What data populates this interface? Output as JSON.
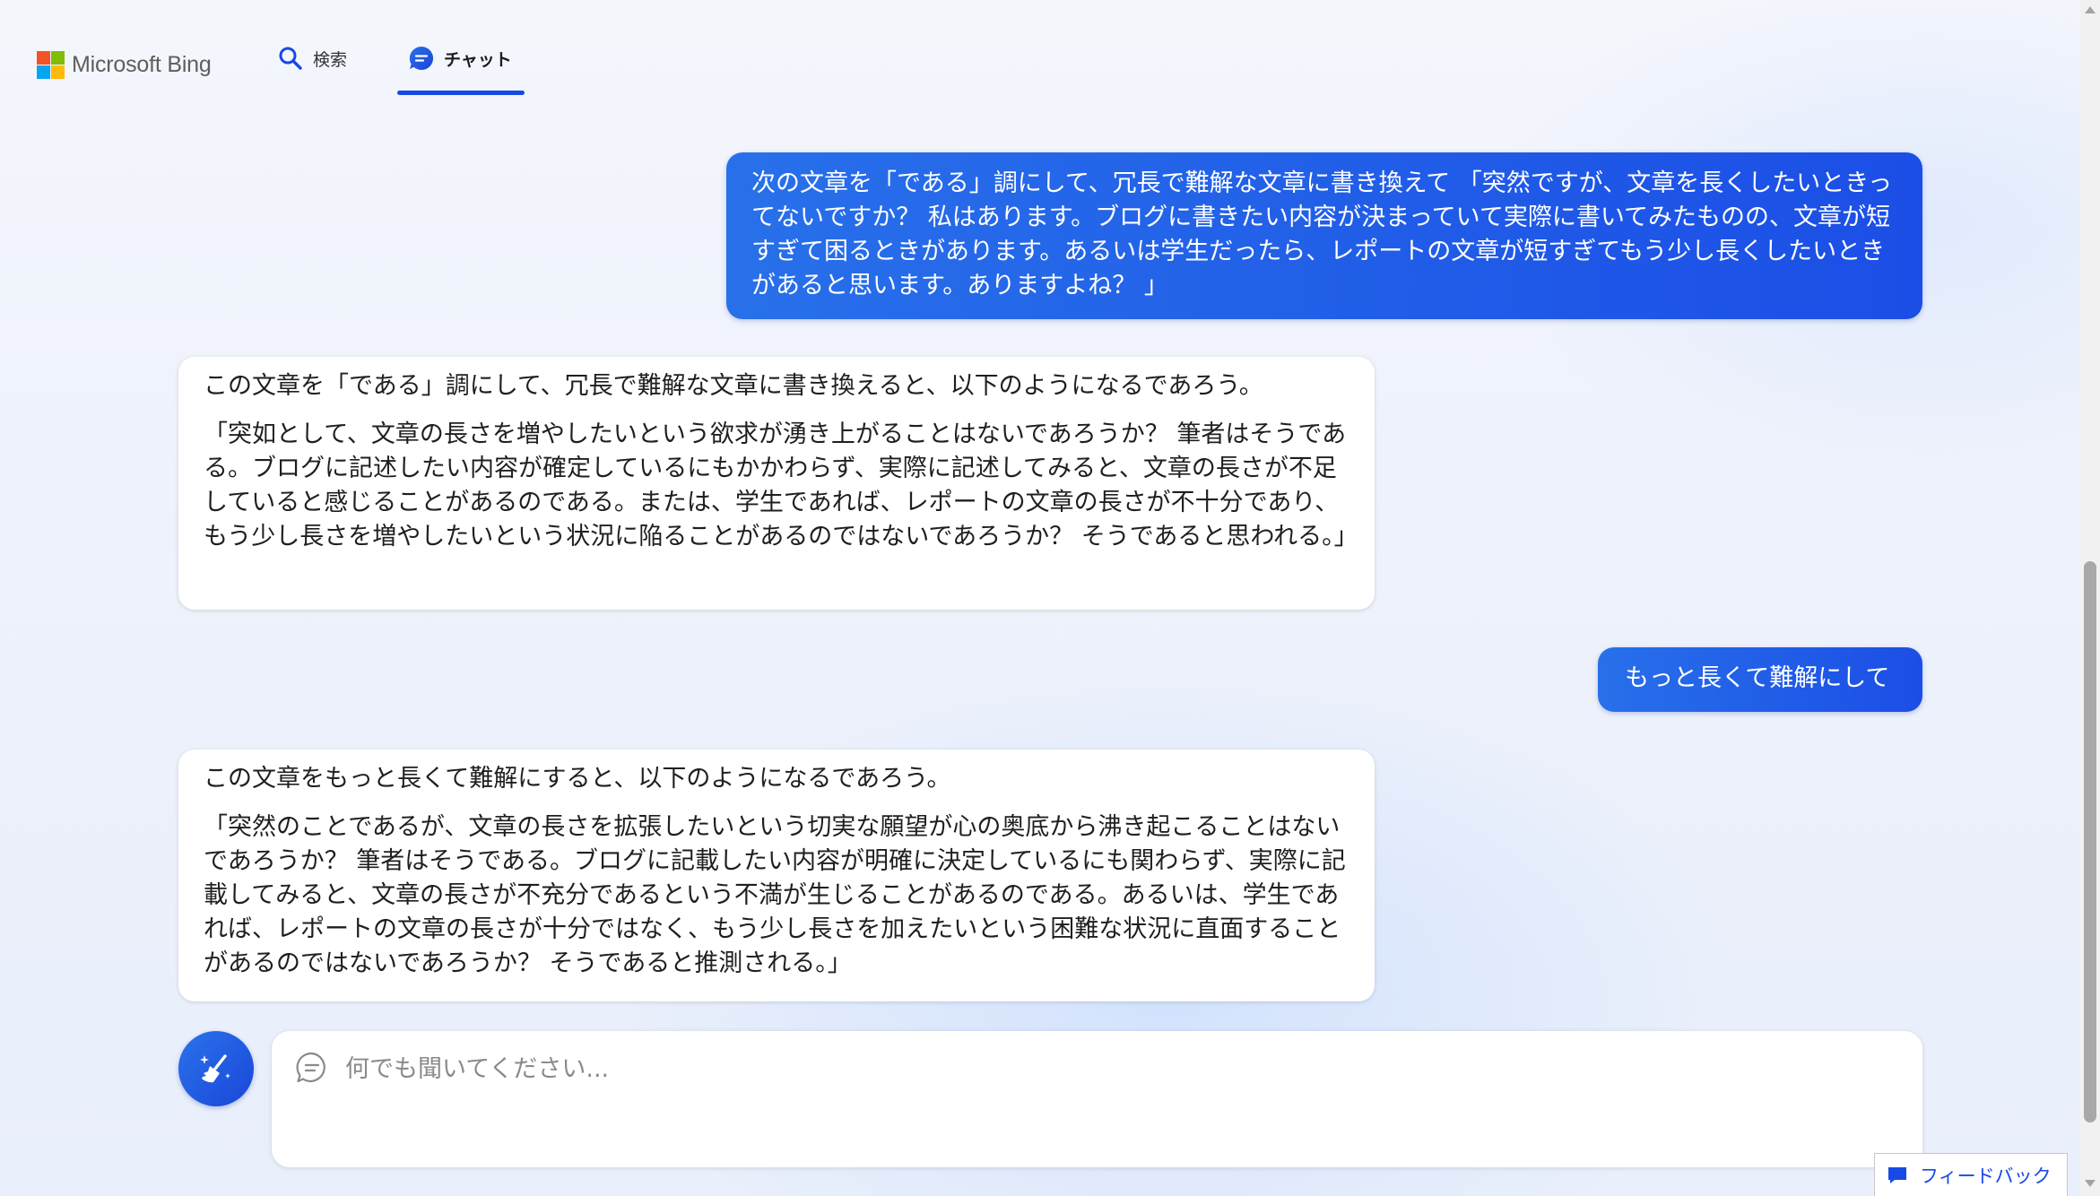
{
  "app": {
    "brand": "Microsoft Bing",
    "brand_colors": [
      "#f35325",
      "#81bc06",
      "#05a6f0",
      "#ffba08"
    ],
    "accent": "#174ae4"
  },
  "nav": {
    "tabs": [
      {
        "label": "検索",
        "icon": "search-icon",
        "active": false
      },
      {
        "label": "チャット",
        "icon": "chat-icon",
        "active": true
      }
    ]
  },
  "conversation": {
    "messages": [
      {
        "role": "user",
        "text": "次の文章を「である」調にして、冗長で難解な文章に書き換えて 「突然ですが、文章を長くしたいときってないですか？ 私はあります。ブログに書きたい内容が決まっていて実際に書いてみたものの、文章が短すぎて困るときがあります。あるいは学生だったら、レポートの文章が短すぎてもう少し長くしたいときがあると思います。ありますよね？ 」"
      },
      {
        "role": "bot",
        "intro": "この文章を「である」調にして、冗長で難解な文章に書き換えると、以下のようになるであろう。",
        "quote": "「突如として、文章の長さを増やしたいという欲求が湧き上がることはないであろうか？ 筆者はそうである。ブログに記述したい内容が確定しているにもかかわらず、実際に記述してみると、文章の長さが不足していると感じることがあるのである。または、学生であれば、レポートの文章の長さが不十分であり、もう少し長さを増やしたいという状況に陥ることがあるのではないであろうか？ そうであると思われる。」"
      },
      {
        "role": "user",
        "text": "もっと長くて難解にして"
      },
      {
        "role": "bot",
        "intro": "この文章をもっと長くて難解にすると、以下のようになるであろう。",
        "quote": "「突然のことであるが、文章の長さを拡張したいという切実な願望が心の奥底から沸き起こることはないであろうか？ 筆者はそうである。ブログに記載したい内容が明確に決定しているにも関わらず、実際に記載してみると、文章の長さが不充分であるという不満が生じることがあるのである。あるいは、学生であれば、レポートの文章の長さが十分ではなく、もう少し長さを加えたいという困難な状況に直面することがあるのではないであろうか？ そうであると推測される。」"
      }
    ]
  },
  "composer": {
    "placeholder": "何でも聞いてください...",
    "value": "",
    "new_topic_icon": "broom-sparkle-icon",
    "input_icon": "chat-bubble-icon"
  },
  "feedback": {
    "label": "フィードバック",
    "icon": "feedback-icon"
  }
}
